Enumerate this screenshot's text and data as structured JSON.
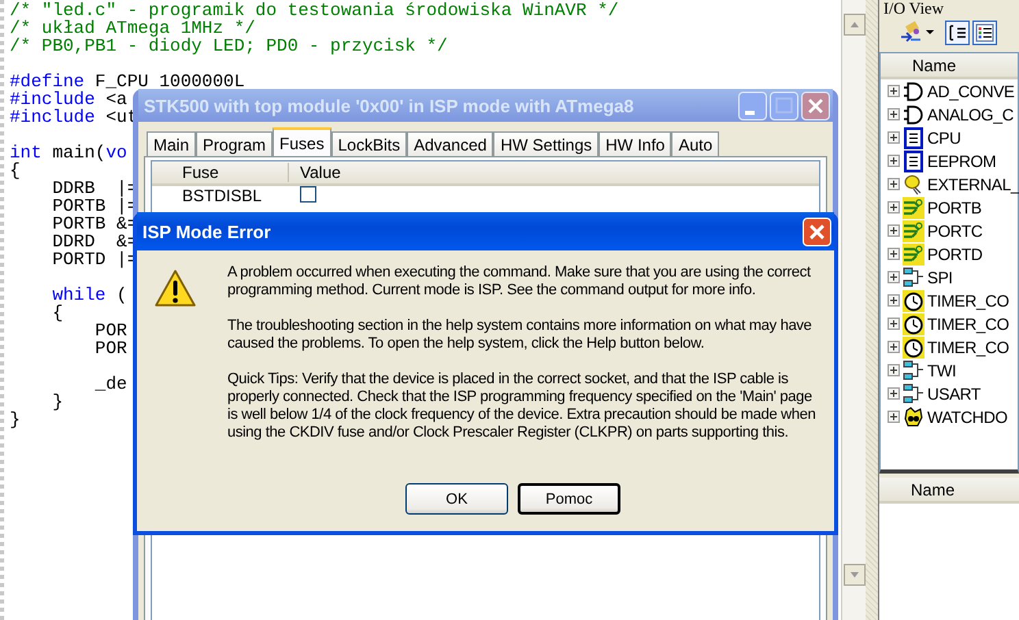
{
  "editor": {
    "code_blocks": [
      [
        [
          {
            "text": "/* \"led.c\" - programik do testowania środowiska WinAVR */",
            "kind": "comment"
          }
        ],
        [
          {
            "text": "/* układ ATmega 1MHz */",
            "kind": "comment"
          }
        ],
        [
          {
            "text": "/* PB0,PB1 - diody LED; PD0 - przycisk */",
            "kind": "comment"
          }
        ]
      ],
      [
        [
          {
            "text": "#define",
            "kind": "keyword"
          },
          {
            "text": " F_CPU 1000000L",
            "kind": "plain"
          }
        ],
        [
          {
            "text": "#include",
            "kind": "keyword"
          },
          {
            "text": " <a",
            "kind": "plain"
          }
        ],
        [
          {
            "text": "#include",
            "kind": "keyword"
          },
          {
            "text": " <ut",
            "kind": "plain"
          }
        ]
      ],
      [
        [
          {
            "text": "int",
            "kind": "keyword"
          },
          {
            "text": " main(",
            "kind": "plain"
          },
          {
            "text": "vo",
            "kind": "keyword"
          }
        ],
        [
          {
            "text": "{",
            "kind": "plain"
          }
        ],
        [
          {
            "text": "    DDRB  |=",
            "kind": "plain"
          }
        ],
        [
          {
            "text": "    PORTB |=",
            "kind": "plain"
          }
        ],
        [
          {
            "text": "    PORTB &=",
            "kind": "plain"
          }
        ],
        [
          {
            "text": "    DDRD  &=",
            "kind": "plain"
          }
        ],
        [
          {
            "text": "    PORTD |=",
            "kind": "plain"
          }
        ]
      ],
      [
        [
          {
            "text": "    while",
            "kind": "keyword"
          },
          {
            "text": " (",
            "kind": "plain"
          }
        ],
        [
          {
            "text": "    {",
            "kind": "plain"
          }
        ],
        [
          {
            "text": "        POR",
            "kind": "plain"
          }
        ],
        [
          {
            "text": "        POR",
            "kind": "plain"
          }
        ]
      ],
      [
        [
          {
            "text": "        _de",
            "kind": "plain"
          }
        ],
        [
          {
            "text": "    }",
            "kind": "plain"
          }
        ],
        [
          {
            "text": "}",
            "kind": "plain"
          }
        ]
      ]
    ]
  },
  "io_view": {
    "title": "I/O View",
    "column": "Name",
    "items": [
      {
        "label": "AD_CONVE",
        "kind": "gate"
      },
      {
        "label": "ANALOG_C",
        "kind": "gate"
      },
      {
        "label": "CPU",
        "kind": "doc"
      },
      {
        "label": "EEPROM",
        "kind": "doc"
      },
      {
        "label": "EXTERNAL_",
        "kind": "bulb"
      },
      {
        "label": "PORTB",
        "kind": "port"
      },
      {
        "label": "PORTC",
        "kind": "port"
      },
      {
        "label": "PORTD",
        "kind": "port"
      },
      {
        "label": "SPI",
        "kind": "net"
      },
      {
        "label": "TIMER_CO",
        "kind": "timer"
      },
      {
        "label": "TIMER_CO",
        "kind": "timer"
      },
      {
        "label": "TIMER_CO",
        "kind": "timer"
      },
      {
        "label": "TWI",
        "kind": "net"
      },
      {
        "label": "USART",
        "kind": "net"
      },
      {
        "label": "WATCHDO",
        "kind": "dog"
      }
    ],
    "lower_column": "Name"
  },
  "stk_window": {
    "title": "STK500 with top module '0x00' in ISP mode with ATmega8",
    "tabs": [
      {
        "label": "Main",
        "selected": false
      },
      {
        "label": "Program",
        "selected": false
      },
      {
        "label": "Fuses",
        "selected": true
      },
      {
        "label": "LockBits",
        "selected": false
      },
      {
        "label": "Advanced",
        "selected": false
      },
      {
        "label": "HW Settings",
        "selected": false
      },
      {
        "label": "HW Info",
        "selected": false
      },
      {
        "label": "Auto",
        "selected": false
      }
    ],
    "columns": [
      "Fuse",
      "Value"
    ],
    "rows": [
      {
        "fuse": "BSTDISBL",
        "checked": false
      }
    ]
  },
  "error_dialog": {
    "title": "ISP Mode Error",
    "paragraphs": [
      "A problem occurred when executing the command. Make sure that you are using the correct programming method. Current mode is ISP. See the command output for more info.",
      "The troubleshooting section in the help system contains more information on what may have caused the problems. To open the help system, click the Help button below.",
      "Quick Tips: Verify that the device is placed in the correct socket, and that the ISP cable is properly connected. Check that the ISP programming frequency specified on the 'Main' page is well below 1/4 of the clock frequency of the device. Extra precaution should be made when using the CKDIV fuse and/or Clock Prescaler Register (CLKPR) on parts supporting this."
    ],
    "buttons": [
      {
        "label": "OK",
        "focused": false
      },
      {
        "label": "Pomoc",
        "focused": true
      }
    ]
  }
}
